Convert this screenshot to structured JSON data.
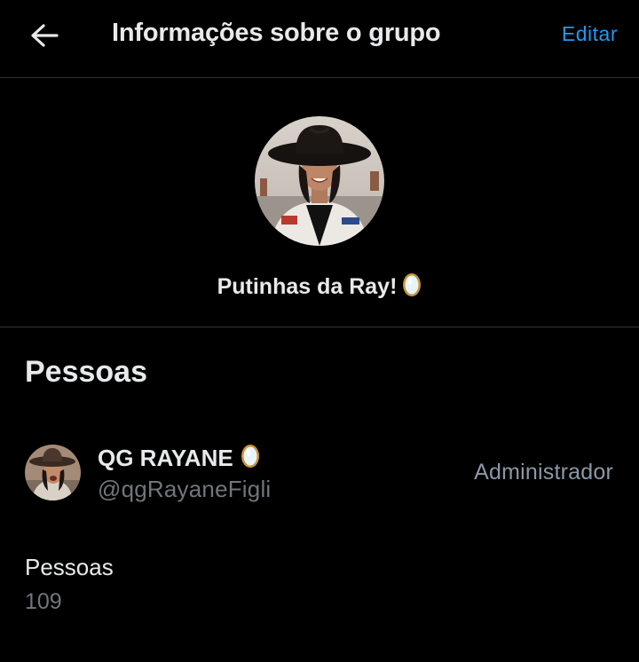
{
  "header": {
    "back_icon": "arrow-left-icon",
    "title": "Informações sobre o grupo",
    "edit_label": "Editar"
  },
  "group": {
    "avatar_icon": "group-avatar-photo",
    "name": "Putinhas da Ray!",
    "name_emoji_icon": "mirror-icon"
  },
  "people": {
    "heading": "Pessoas",
    "members": [
      {
        "name": "QG RAYANE",
        "name_emoji_icon": "mirror-icon",
        "handle": "@qgRayaneFigli",
        "role": "Administrador",
        "avatar_icon": "member-avatar-photo"
      }
    ],
    "count_label": "Pessoas",
    "count_value": "109"
  },
  "colors": {
    "background": "#000000",
    "text_primary": "#e7e9ea",
    "text_secondary": "#71767b",
    "accent": "#1d9bf0",
    "divider": "#2f3336"
  }
}
